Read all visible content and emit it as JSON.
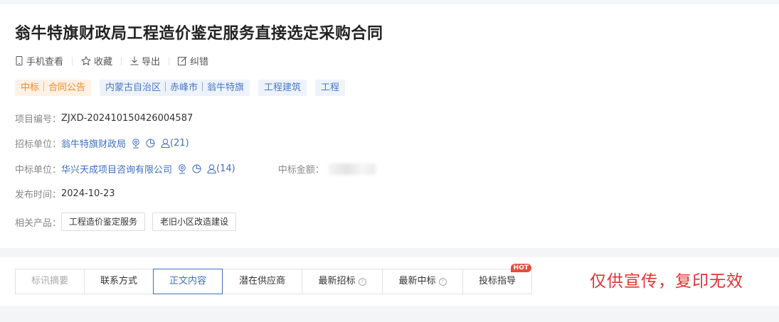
{
  "title": "翁牛特旗财政局工程造价鉴定服务直接选定采购合同",
  "actions": {
    "mobile": "手机查看",
    "favorite": "收藏",
    "export": "导出",
    "correct": "纠错"
  },
  "tags": {
    "status": "中标｜合同公告",
    "region": "内蒙古自治区｜赤峰市｜翁牛特旗",
    "industry": "工程建筑",
    "category": "工程"
  },
  "info": {
    "project_no_label": "项目编号：",
    "project_no": "ZJXD-202410150426004587",
    "tenderer_label": "招标单位：",
    "tenderer": "翁牛特旗财政局",
    "tenderer_count": "(21)",
    "winner_label": "中标单位：",
    "winner": "华兴天成项目咨询有限公司",
    "winner_count": "(14)",
    "amount_label": "中标金额：",
    "date_label": "发布时间：",
    "date": "2024-10-23",
    "products_label": "相关产品：",
    "products": [
      "工程造价鉴定服务",
      "老旧小区改造建设"
    ]
  },
  "tabs": {
    "summary": "标讯摘要",
    "contact": "联系方式",
    "content": "正文内容",
    "suppliers": "潜在供应商",
    "latest_bids": "最新招标",
    "latest_wins": "最新中标",
    "guide": "投标指导",
    "hot_badge": "HOT"
  },
  "notice": "仅供宣传，复印无效",
  "colors": {
    "accent": "#3f6fc1",
    "orange": "#f08a24",
    "hot": "#e74c3c",
    "notice": "#e03333"
  }
}
